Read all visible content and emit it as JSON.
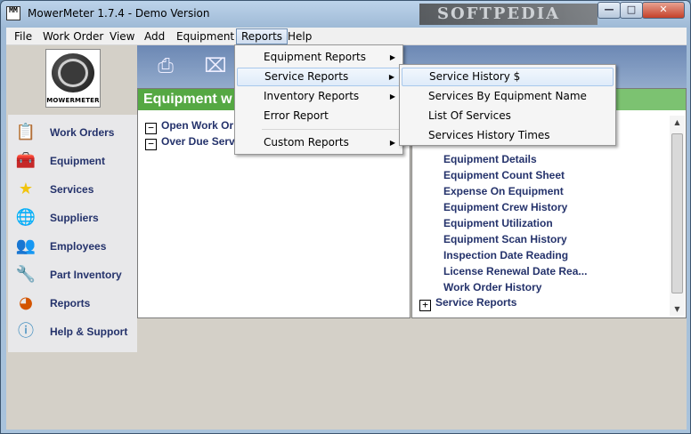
{
  "window": {
    "title": "MowerMeter 1.7.4 - Demo Version",
    "app_icon_text": "MM",
    "watermark": "SOFTPEDIA"
  },
  "titlebar": {
    "min_glyph": "—",
    "max_glyph": "□",
    "close_glyph": "✕"
  },
  "menubar": {
    "items": [
      "File",
      "Work Order",
      "View",
      "Add",
      "Equipment",
      "Reports",
      "Help"
    ],
    "active": "Reports"
  },
  "logo": {
    "text": "MOWERMETER"
  },
  "sidebar": {
    "items": [
      {
        "label": "Work Orders",
        "icon": "clipboard-icon"
      },
      {
        "label": "Equipment",
        "icon": "toolbox-icon"
      },
      {
        "label": "Services",
        "icon": "star-icon"
      },
      {
        "label": "Suppliers",
        "icon": "globe-icon"
      },
      {
        "label": "Employees",
        "icon": "people-icon"
      },
      {
        "label": "Part Inventory",
        "icon": "wrench-icon"
      },
      {
        "label": "Reports",
        "icon": "pie-chart-icon"
      },
      {
        "label": "Help & Support",
        "icon": "info-icon"
      }
    ]
  },
  "left_panel": {
    "header": "Equipment w",
    "rows": [
      {
        "toggle": "−",
        "label": "Open Work Or"
      },
      {
        "toggle": "−",
        "label": "Over Due Serv"
      }
    ]
  },
  "right_panel": {
    "items": [
      "Equipment Details",
      "Equipment Count Sheet",
      "Expense On Equipment",
      "Equipment Crew History",
      "Equipment Utilization",
      "Equipment Scan History",
      "Inspection Date Reading",
      "License Renewal Date Rea...",
      "Work Order History"
    ],
    "footer_node": {
      "toggle": "+",
      "label": "Service Reports"
    }
  },
  "reports_menu": {
    "items": [
      {
        "label": "Equipment Reports",
        "submenu": true
      },
      {
        "label": "Service Reports",
        "submenu": true,
        "highlighted": true
      },
      {
        "label": "Inventory Reports",
        "submenu": true
      },
      {
        "label": "Error Report",
        "submenu": false
      },
      {
        "label": "Custom Reports",
        "submenu": true
      }
    ]
  },
  "service_submenu": {
    "items": [
      {
        "label": "Service History $",
        "highlighted": true
      },
      {
        "label": "Services By Equipment Name"
      },
      {
        "label": "List Of Services"
      },
      {
        "label": "Services History Times"
      }
    ]
  },
  "colors": {
    "panel_header_green": "#55a843",
    "link_blue": "#24326b",
    "toolbar_blue": "#7a95bf"
  }
}
